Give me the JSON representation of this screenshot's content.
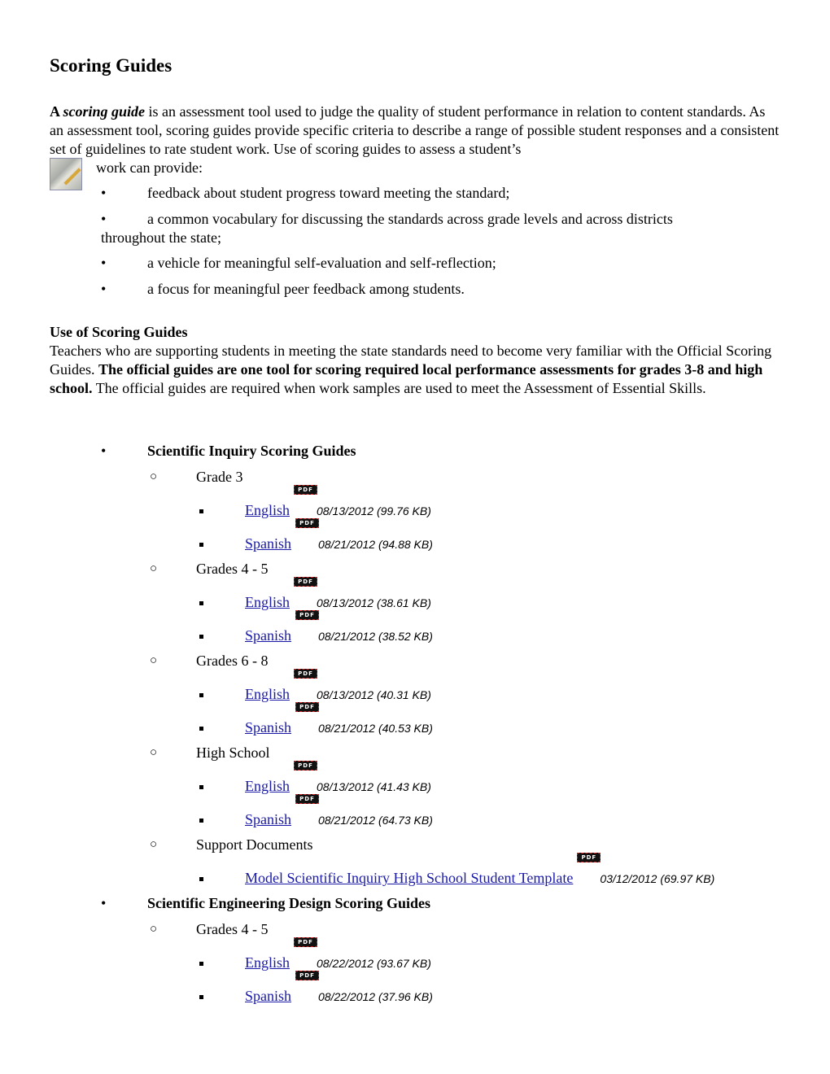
{
  "title": "Scoring Guides",
  "intro": {
    "lead": "A ",
    "term": "scoring guide",
    "text": " is an assessment tool used to judge the quality of student performance in relation to content standards. As an assessment tool, scoring guides provide specific criteria to describe a range of possible student responses and a consistent set of guidelines to rate student work. Use of scoring guides to assess a student’s",
    "text2": "work can provide:"
  },
  "benefits": [
    "feedback about student progress toward meeting the standard;",
    "a common vocabulary for discussing the standards across grade levels and across districts",
    "throughout the state;",
    "a vehicle for meaningful self-evaluation and self-reflection;",
    "a focus for meaningful peer feedback among students."
  ],
  "use": {
    "heading": "Use of Scoring Guides",
    "text1": "Teachers who are supporting students in meeting the state standards need to become very familiar with the Official Scoring Guides. ",
    "bold": "The official guides are one tool for scoring required local performance assessments for grades 3-8 and high school.",
    "text2": " The official guides are required when work samples are used to meet the Assessment of Essential Skills."
  },
  "pdf_label": "PDF",
  "sections": [
    {
      "title": "Scientific Inquiry Scoring Guides",
      "groups": [
        {
          "title": "Grade 3",
          "files": [
            {
              "label": "English",
              "date": "08/13/2012 (99.76 KB)"
            },
            {
              "label": "Spanish",
              "date": "08/21/2012 (94.88 KB)"
            }
          ]
        },
        {
          "title": "Grades 4 - 5",
          "files": [
            {
              "label": "English",
              "date": "08/13/2012 (38.61 KB)"
            },
            {
              "label": "Spanish",
              "date": "08/21/2012 (38.52 KB)"
            }
          ]
        },
        {
          "title": "Grades 6 - 8",
          "files": [
            {
              "label": "English",
              "date": "08/13/2012 (40.31 KB)"
            },
            {
              "label": "Spanish",
              "date": "08/21/2012 (40.53 KB)"
            }
          ]
        },
        {
          "title": "High School",
          "files": [
            {
              "label": "English",
              "date": "08/13/2012 (41.43 KB)"
            },
            {
              "label": "Spanish",
              "date": "08/21/2012 (64.73 KB)"
            }
          ]
        },
        {
          "title": "Support Documents",
          "files": [
            {
              "label": "Model Scientific Inquiry High School Student Template",
              "date": "03/12/2012 (69.97 KB)"
            }
          ]
        }
      ]
    },
    {
      "title": "Scientific Engineering Design Scoring Guides",
      "groups": [
        {
          "title": "Grades 4 - 5",
          "files": [
            {
              "label": "English",
              "date": "08/22/2012 (93.67 KB)"
            },
            {
              "label": "Spanish",
              "date": "08/22/2012 (37.96 KB)"
            }
          ]
        }
      ]
    }
  ]
}
